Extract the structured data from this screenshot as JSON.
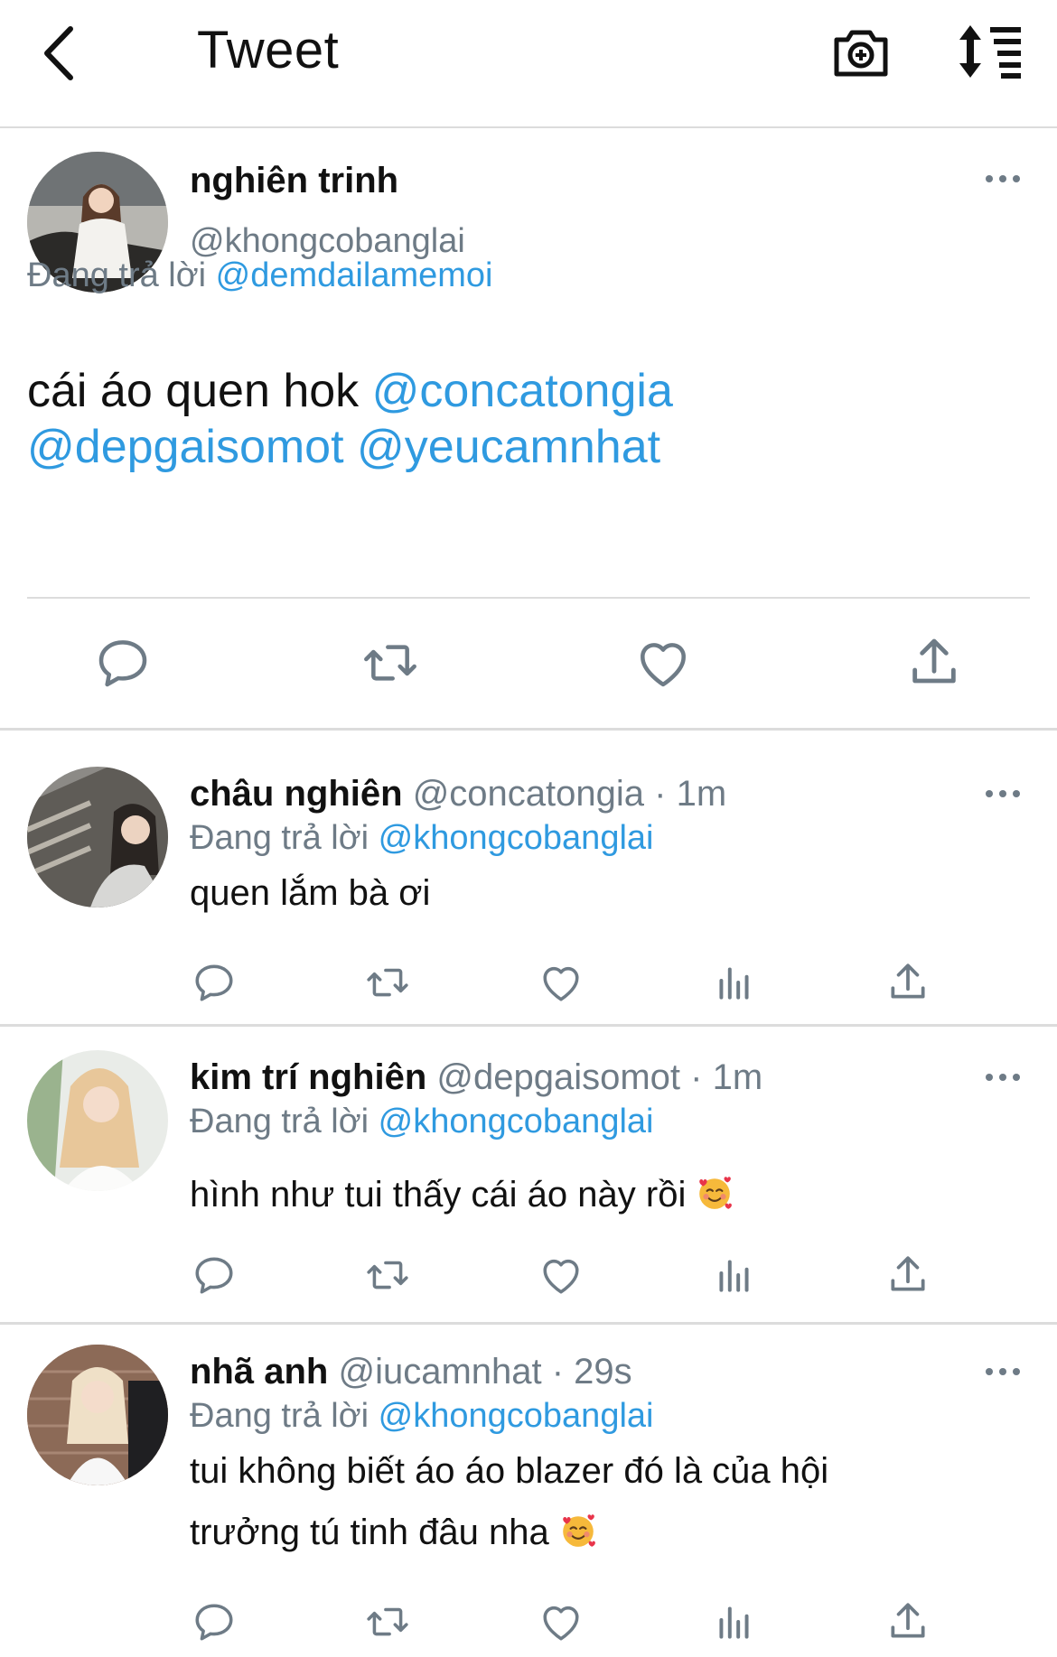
{
  "header": {
    "title": "Tweet"
  },
  "colors": {
    "accent": "#2f9ae0",
    "secondary": "#6e7b86",
    "icon": "#6e7b86"
  },
  "main_tweet": {
    "name": "nghiên trinh",
    "handle": "@khongcobanglai",
    "reply_label": "Đang trả lời",
    "reply_to": "@demdailamemoi",
    "text": "cái áo quen hok",
    "mentions": [
      "@concatongia",
      "@depgaisomot",
      "@yeucamnhat"
    ]
  },
  "replies": [
    {
      "name": "châu nghiên",
      "handle": "@concatongia",
      "time": "· 1m",
      "reply_label": "Đang trả lời",
      "reply_to": "@khongcobanglai",
      "text": "quen lắm bà ơi"
    },
    {
      "name": "kim trí nghiên",
      "handle": "@depgaisomot",
      "time": "· 1m",
      "reply_label": "Đang trả lời",
      "reply_to": "@khongcobanglai",
      "text": "hình như tui thấy cái áo này rồi",
      "emoji": "smiling-face-with-hearts"
    },
    {
      "name": "nhã anh",
      "handle": "@iucamnhat",
      "time": "· 29s",
      "reply_label": "Đang trả lời",
      "reply_to": "@khongcobanglai",
      "text_line1": "tui không biết áo áo blazer đó là của hội",
      "text_line2": "trưởng tú tinh đâu nha",
      "emoji": "smiling-face-with-hearts"
    }
  ],
  "icons": {
    "back": "chevron-left-icon",
    "camera": "camera-icon",
    "sort": "sort-icon",
    "reply": "reply-icon",
    "retweet": "retweet-icon",
    "like": "heart-icon",
    "analytics": "analytics-icon",
    "share": "share-icon",
    "more": "more-icon"
  }
}
